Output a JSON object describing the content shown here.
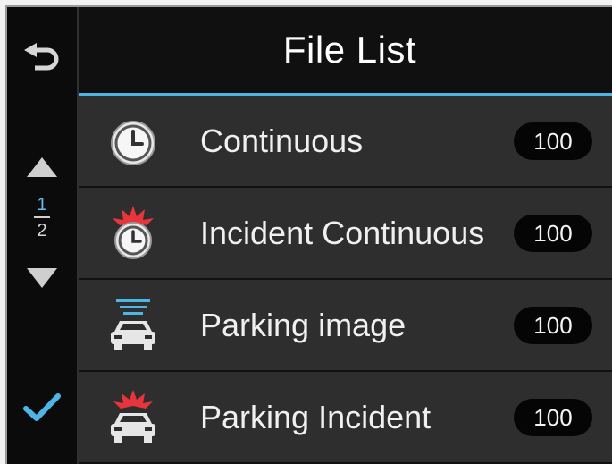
{
  "header": {
    "title": "File List"
  },
  "sidebar": {
    "back_icon": "back-arrow-icon",
    "up_icon": "triangle-up-icon",
    "down_icon": "triangle-down-icon",
    "confirm_icon": "checkmark-icon",
    "page_current": "1",
    "page_total": "2"
  },
  "items": [
    {
      "label": "Continuous",
      "count": "100",
      "icon": "clock-icon"
    },
    {
      "label": "Incident Continuous",
      "count": "100",
      "icon": "clock-alert-icon"
    },
    {
      "label": "Parking image",
      "count": "100",
      "icon": "parked-car-icon"
    },
    {
      "label": "Parking Incident",
      "count": "100",
      "icon": "car-alert-icon"
    }
  ],
  "colors": {
    "accent": "#4fb5e6",
    "alert": "#e8353c",
    "row_bg": "#2e2e2e",
    "background": "#0d0d0d"
  }
}
